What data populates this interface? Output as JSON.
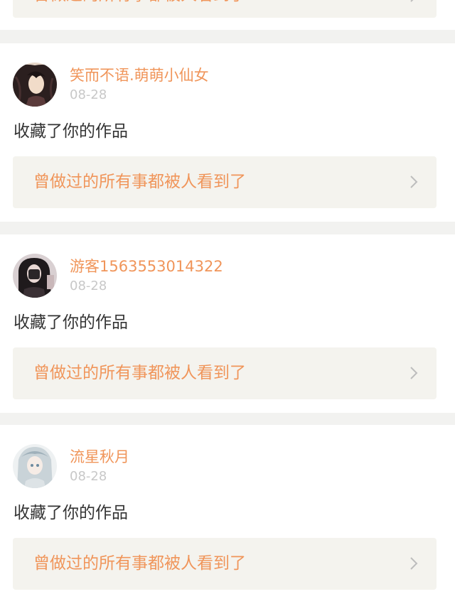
{
  "feed": {
    "items": [
      {
        "username": "",
        "date": "",
        "action": "",
        "work_title": "曾做过的所有事都被人看到了",
        "avatar_icon": "chevron-right-icon"
      },
      {
        "username": "笑而不语.萌萌小仙女",
        "date": "08-28",
        "action": "收藏了你的作品",
        "work_title": "曾做过的所有事都被人看到了",
        "avatar_icon": "avatar-anime-dark-hair"
      },
      {
        "username": "游客1563553014322",
        "date": "08-28",
        "action": "收藏了你的作品",
        "work_title": "曾做过的所有事都被人看到了",
        "avatar_icon": "avatar-photo-dark-hair"
      },
      {
        "username": "流星秋月",
        "date": "08-28",
        "action": "收藏了你的作品",
        "work_title": "曾做过的所有事都被人看到了",
        "avatar_icon": "avatar-anime-light-hair"
      }
    ]
  },
  "colors": {
    "accent": "#f0955a",
    "date": "#c8c8c8",
    "text": "#333333",
    "link_bg": "#f4f3ee",
    "page_bg": "#f2f2f0"
  }
}
